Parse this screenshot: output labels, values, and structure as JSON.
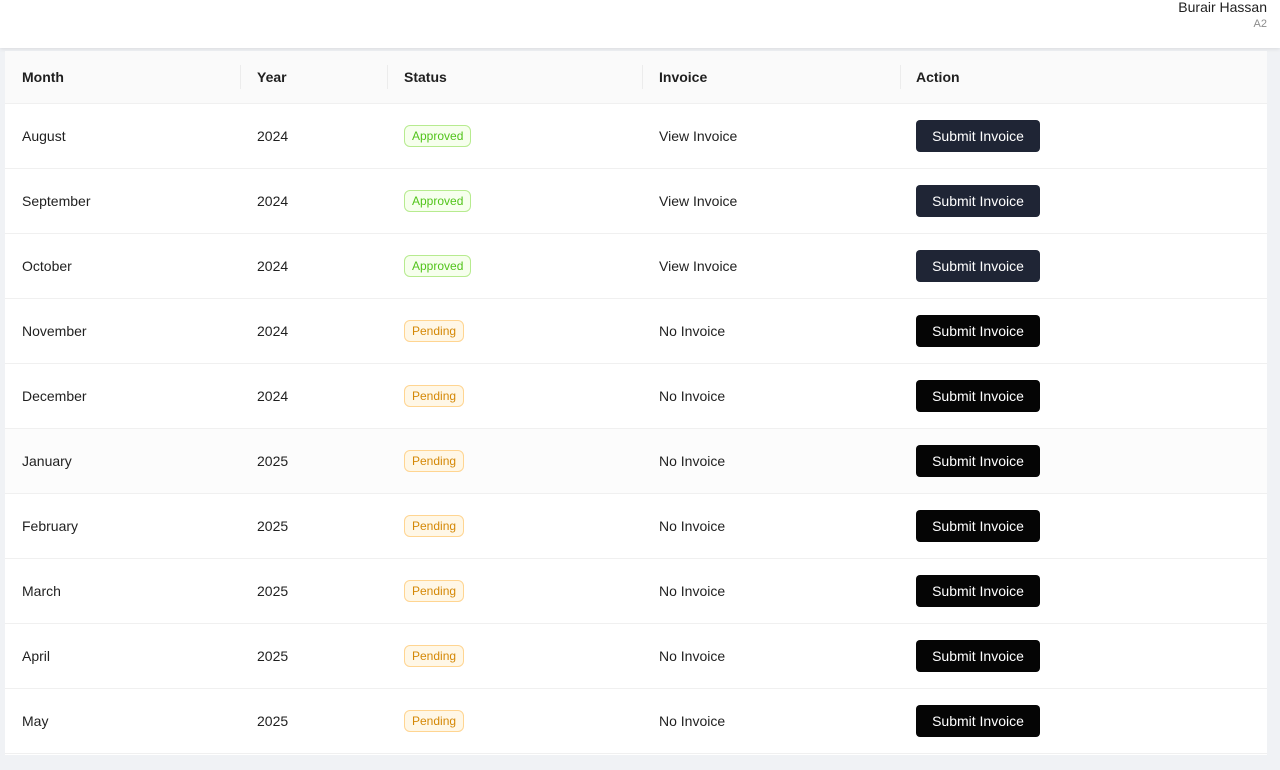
{
  "user": {
    "name": "Burair Hassan",
    "sub": "A2"
  },
  "table": {
    "headers": {
      "month": "Month",
      "year": "Year",
      "status": "Status",
      "invoice": "Invoice",
      "action": "Action"
    },
    "rows": [
      {
        "month": "August",
        "year": "2024",
        "status": "Approved",
        "invoice": "View Invoice",
        "action": "Submit Invoice"
      },
      {
        "month": "September",
        "year": "2024",
        "status": "Approved",
        "invoice": "View Invoice",
        "action": "Submit Invoice"
      },
      {
        "month": "October",
        "year": "2024",
        "status": "Approved",
        "invoice": "View Invoice",
        "action": "Submit Invoice"
      },
      {
        "month": "November",
        "year": "2024",
        "status": "Pending",
        "invoice": "No Invoice",
        "action": "Submit Invoice"
      },
      {
        "month": "December",
        "year": "2024",
        "status": "Pending",
        "invoice": "No Invoice",
        "action": "Submit Invoice"
      },
      {
        "month": "January",
        "year": "2025",
        "status": "Pending",
        "invoice": "No Invoice",
        "action": "Submit Invoice"
      },
      {
        "month": "February",
        "year": "2025",
        "status": "Pending",
        "invoice": "No Invoice",
        "action": "Submit Invoice"
      },
      {
        "month": "March",
        "year": "2025",
        "status": "Pending",
        "invoice": "No Invoice",
        "action": "Submit Invoice"
      },
      {
        "month": "April",
        "year": "2025",
        "status": "Pending",
        "invoice": "No Invoice",
        "action": "Submit Invoice"
      },
      {
        "month": "May",
        "year": "2025",
        "status": "Pending",
        "invoice": "No Invoice",
        "action": "Submit Invoice"
      }
    ]
  },
  "colors": {
    "approved_text": "#52c41a",
    "pending_text": "#d48806",
    "button_approved": "#1f2535",
    "button_pending": "#050505"
  }
}
